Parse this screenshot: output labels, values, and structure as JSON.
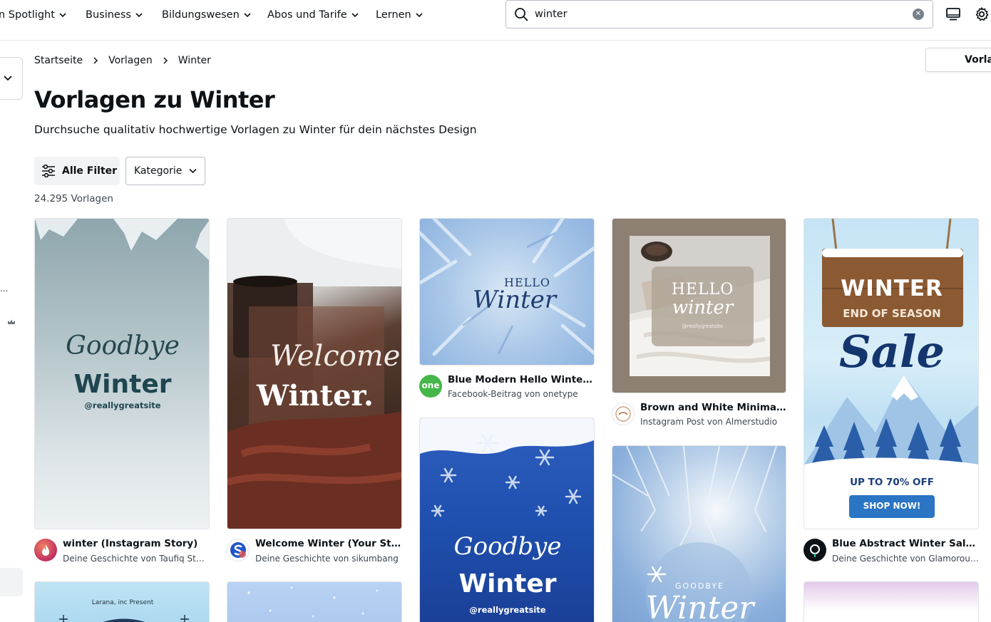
{
  "nav": {
    "items": [
      {
        "label": "n Spotlight"
      },
      {
        "label": "Business"
      },
      {
        "label": "Bildungswesen"
      },
      {
        "label": "Abos und Tarife"
      },
      {
        "label": "Lernen"
      }
    ],
    "search_value": "winter"
  },
  "breadcrumb": {
    "items": [
      "Startseite",
      "Vorlagen",
      "Winter"
    ]
  },
  "right_tab": {
    "label": "Vorlag"
  },
  "page": {
    "title": "Vorlagen zu Winter",
    "subtitle": "Durchsuche qualitativ hochwertige Vorlagen zu Winter für dein nächstes Design",
    "filter_label": "Alle Filter",
    "category_label": "Kategorie",
    "count": "24.295 Vorlagen"
  },
  "left": {
    "dots": "..."
  },
  "cards": [
    {
      "title": "winter (Instagram Story)",
      "subtitle": "Deine Geschichte von Taufiq Studio",
      "art": {
        "script": "Goodbye",
        "headline": "Winter",
        "handle": "@reallygreatsite"
      }
    },
    {
      "title": "Welcome Winter (Your Story)",
      "subtitle": "Deine Geschichte von sikumbang",
      "art": {
        "script": "Welcome",
        "headline": "Winter."
      }
    },
    {
      "title": "Blue Modern Hello Winter Fa...",
      "subtitle": "Facebook-Beitrag von onetype",
      "art": {
        "top": "HELLO",
        "script": "Winter"
      },
      "avatar_text": "one"
    },
    {
      "title": "Brown and White Minimalist ...",
      "subtitle": "Instagram Post von Almerstudio",
      "art": {
        "top": "HELLO",
        "script": "winter",
        "small": "@reallygreatsite"
      }
    },
    {
      "title": "Blue Abstract Winter Sale In...",
      "subtitle": "Deine Geschichte von Glamorous ...",
      "art": {
        "sign1": "WINTER",
        "sign2": "END OF SEASON",
        "script": "Sale",
        "offer": "UP TO 70% OFF",
        "cta": "SHOP NOW!"
      }
    },
    {
      "art": {
        "script": "Goodbye",
        "headline": "Winter",
        "handle": "@reallygreatsite"
      }
    },
    {
      "art": {
        "top": "GOODBYE",
        "script": "Winter"
      }
    },
    {
      "art": {
        "top": "Larana, inc Present"
      }
    }
  ],
  "colors": {
    "text": "#0d1216",
    "muted": "#3f474f",
    "border": "#b8bec5",
    "accent_blue": "#1a3e7a"
  }
}
